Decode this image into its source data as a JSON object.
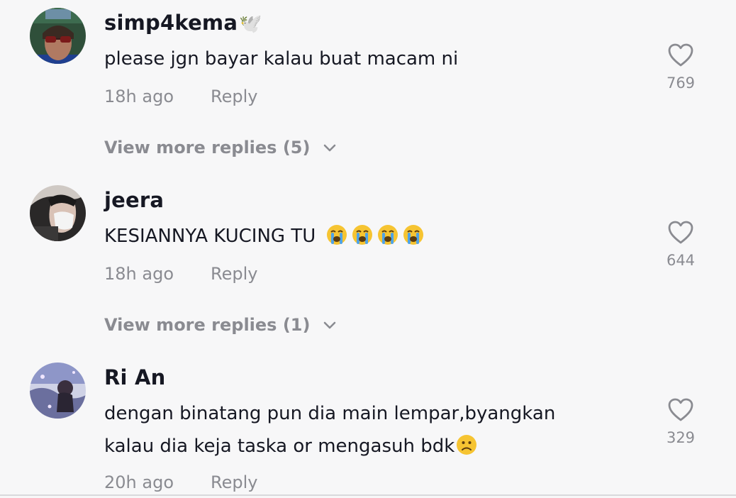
{
  "comments": [
    {
      "username": "simp4kema",
      "username_suffix": "🕊️",
      "lines": [
        "please jgn bayar kalau buat macam ni"
      ],
      "time": "18h ago",
      "reply_label": "Reply",
      "likes": "769",
      "view_more": "View more replies (5)"
    },
    {
      "username": "jeera",
      "lines": [
        "KESIANNYA KUCING TU"
      ],
      "emojis": "😭 😭 😭 😭",
      "time": "18h ago",
      "reply_label": "Reply",
      "likes": "644",
      "view_more": "View more replies (1)"
    },
    {
      "username": "Ri An",
      "lines": [
        "dengan binatang pun dia main lempar,byangkan",
        "kalau dia keja taska or mengasuh bdk"
      ],
      "emojis": "🙁",
      "time": "20h ago",
      "reply_label": "Reply",
      "likes": "329"
    }
  ],
  "icons": {
    "like": "heart-outline-icon",
    "expand": "chevron-down-icon"
  },
  "colors": {
    "background": "#f7f7f8",
    "text": "#161823",
    "muted": "#8a8b91"
  }
}
